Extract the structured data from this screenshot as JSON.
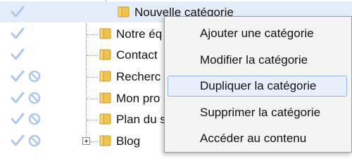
{
  "tree": {
    "items": [
      {
        "label": "Nouvelle catégorie",
        "selected": true,
        "has_ban": false,
        "expandable": false
      },
      {
        "label": "Notre éq",
        "selected": false,
        "has_ban": false,
        "expandable": false
      },
      {
        "label": "Contact",
        "selected": false,
        "has_ban": false,
        "expandable": false
      },
      {
        "label": "Recherc",
        "selected": false,
        "has_ban": true,
        "expandable": false
      },
      {
        "label": "Mon pro",
        "selected": false,
        "has_ban": true,
        "expandable": false
      },
      {
        "label": "Plan du s",
        "selected": false,
        "has_ban": true,
        "expandable": false
      },
      {
        "label": "Blog",
        "selected": false,
        "has_ban": true,
        "expandable": true
      }
    ]
  },
  "context_menu": {
    "items": [
      {
        "label": "Ajouter une catégorie"
      },
      {
        "label": "Modifier la catégorie"
      },
      {
        "label": "Dupliquer la catégorie",
        "hover": true
      },
      {
        "label": "Supprimer la catégorie"
      },
      {
        "label": "Accéder au contenu"
      }
    ]
  },
  "colors": {
    "check": "#aec6ec",
    "ban": "#aec6ec",
    "folder": "#f0c24e",
    "selection": "#e3edfa",
    "menu_hover_border": "#8fb5e6"
  },
  "icons": {
    "status_visible": "check-icon",
    "status_hidden": "ban-icon",
    "category": "folder-icon",
    "expand": "plus-icon"
  }
}
